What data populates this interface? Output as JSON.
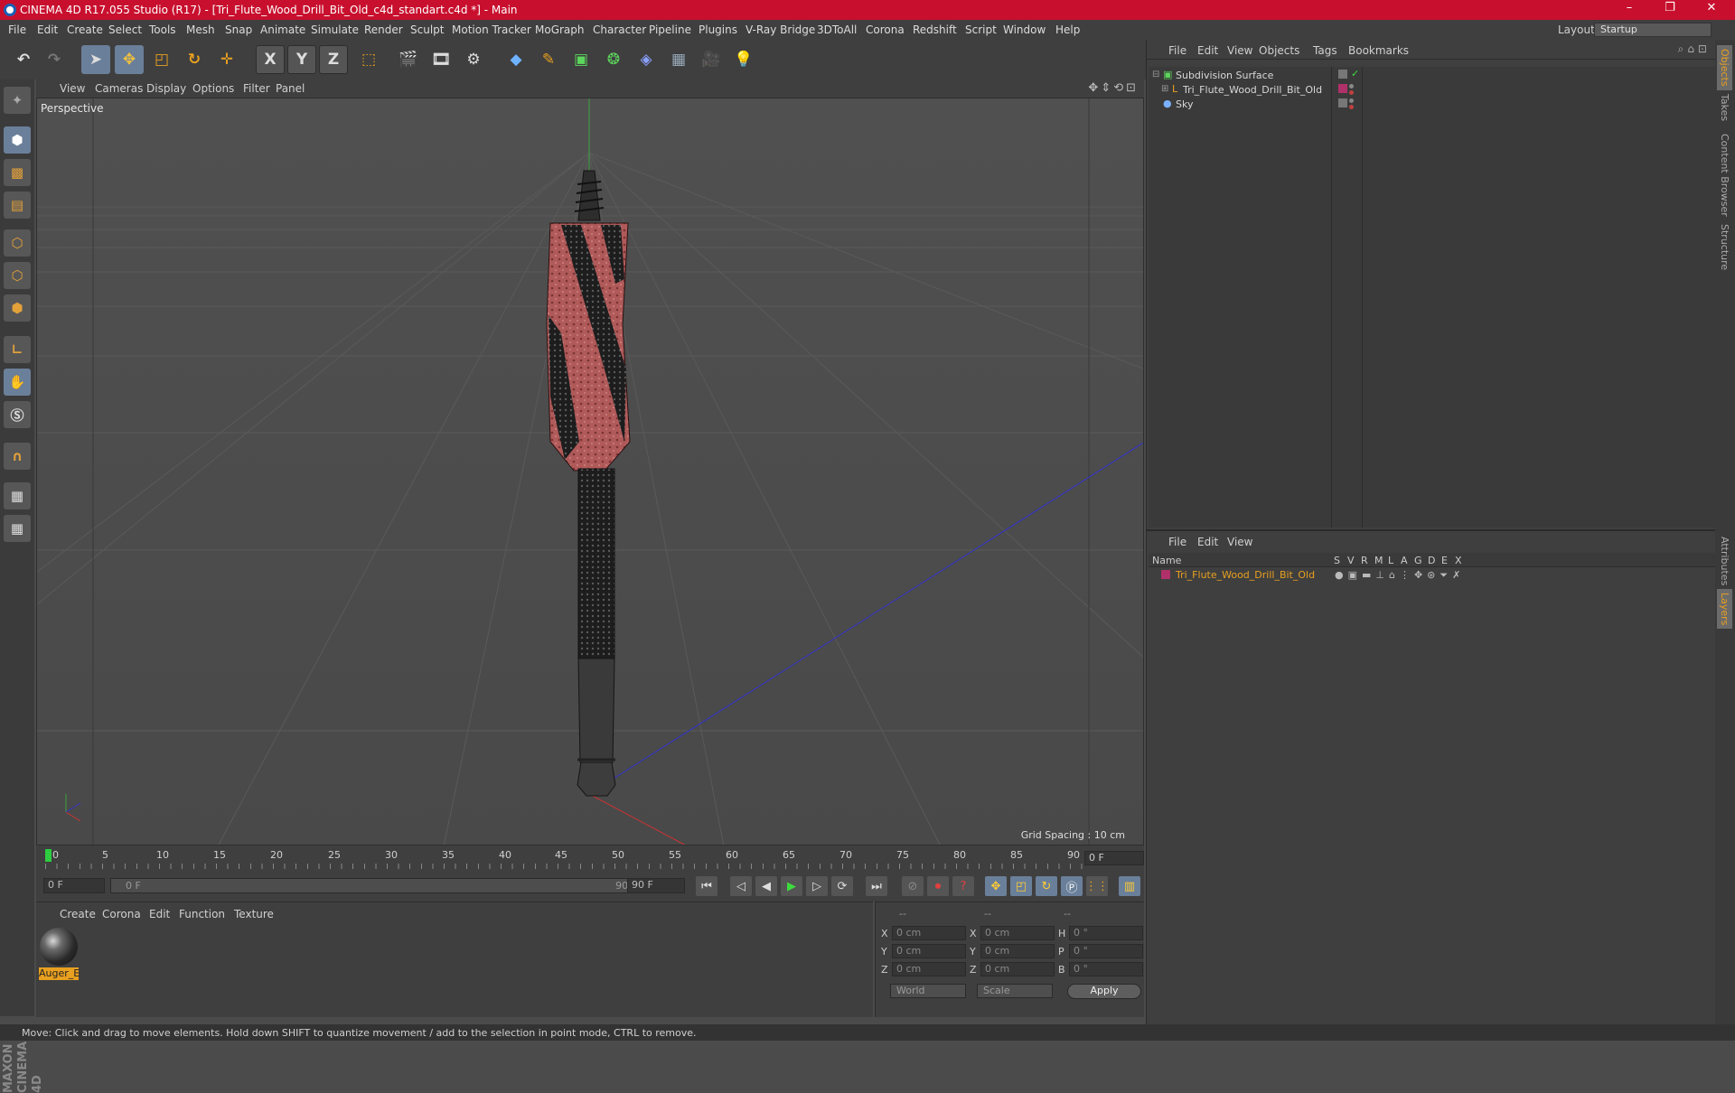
{
  "window": {
    "title": "CINEMA 4D R17.055 Studio (R17) - [Tri_Flute_Wood_Drill_Bit_Old_c4d_standart.c4d *] - Main",
    "minimize": "–",
    "restore": "❐",
    "close": "✕"
  },
  "menubar": {
    "items": [
      "File",
      "Edit",
      "Create",
      "Select",
      "Tools",
      "Mesh",
      "Snap",
      "Animate",
      "Simulate",
      "Render",
      "Sculpt",
      "Motion Tracker",
      "MoGraph",
      "Character",
      "Pipeline",
      "Plugins",
      "V-Ray Bridge",
      "3DToAll",
      "Corona",
      "Redshift",
      "Script",
      "Window",
      "Help"
    ],
    "layout_label": "Layout:",
    "layout_value": "Startup"
  },
  "toolbar": {
    "axis_x": "X",
    "axis_y": "Y",
    "axis_z": "Z"
  },
  "viewport": {
    "menu": [
      "View",
      "Cameras",
      "Display",
      "Options",
      "Filter",
      "Panel"
    ],
    "label": "Perspective",
    "grid_spacing": "Grid Spacing : 10 cm"
  },
  "timeline": {
    "ticks": [
      "0",
      "5",
      "10",
      "15",
      "20",
      "25",
      "30",
      "35",
      "40",
      "45",
      "50",
      "55",
      "60",
      "65",
      "70",
      "75",
      "80",
      "85",
      "90"
    ],
    "current_frame": "0 F",
    "start_field": "0 F",
    "slider_start": "0 F",
    "slider_end": "90 F",
    "end_field": "90 F"
  },
  "materials": {
    "menu": [
      "Create",
      "Corona",
      "Edit",
      "Function",
      "Texture"
    ],
    "items": [
      {
        "name": "Auger_E"
      }
    ]
  },
  "coordinates": {
    "header": [
      "--",
      "--",
      "--"
    ],
    "rows": [
      {
        "a": "X",
        "av": "0 cm",
        "b": "X",
        "bv": "0 cm",
        "c": "H",
        "cv": "0 °"
      },
      {
        "a": "Y",
        "av": "0 cm",
        "b": "Y",
        "bv": "0 cm",
        "c": "P",
        "cv": "0 °"
      },
      {
        "a": "Z",
        "av": "0 cm",
        "b": "Z",
        "bv": "0 cm",
        "c": "B",
        "cv": "0 °"
      }
    ],
    "mode1": "World",
    "mode2": "Scale",
    "apply": "Apply"
  },
  "objects": {
    "menu": [
      "File",
      "Edit",
      "View",
      "Objects",
      "Tags",
      "Bookmarks"
    ],
    "items": [
      {
        "name": "Subdivision Surface"
      },
      {
        "name": "Tri_Flute_Wood_Drill_Bit_Old"
      },
      {
        "name": "Sky"
      }
    ]
  },
  "layers": {
    "menu": [
      "File",
      "Edit",
      "View"
    ],
    "columns": [
      "Name",
      "S",
      "V",
      "R",
      "M",
      "L",
      "A",
      "G",
      "D",
      "E",
      "X"
    ],
    "row": {
      "name": "Tri_Flute_Wood_Drill_Bit_Old",
      "color": "#b0306a"
    }
  },
  "sidetabs": [
    "Objects",
    "Takes",
    "Content Browser",
    "Structure",
    "Attributes",
    "Layers"
  ],
  "status": "Move: Click and drag to move elements. Hold down SHIFT to quantize movement / add to the selection in point mode, CTRL to remove.",
  "colors": {
    "titlebar": "#c8102e",
    "accent": "#e8a020",
    "selected": "#6a7f99"
  },
  "maxon": "MAXON CINEMA 4D"
}
